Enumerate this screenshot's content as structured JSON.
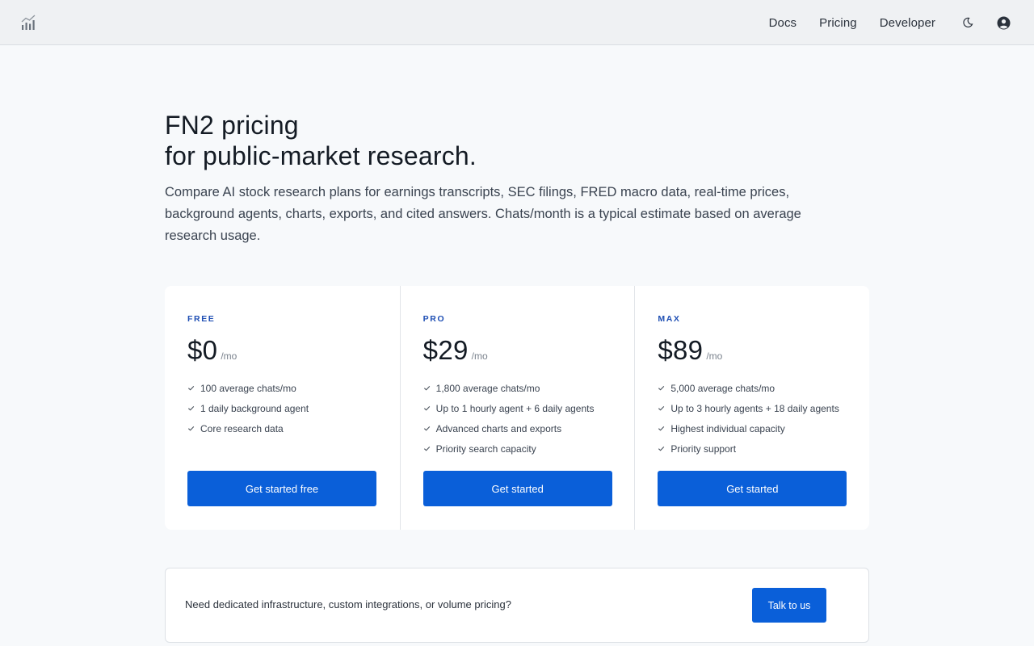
{
  "nav": {
    "items": [
      "Docs",
      "Pricing",
      "Developer"
    ]
  },
  "hero": {
    "title_line1": "FN2 pricing",
    "title_line2": "for public-market research.",
    "subtitle": "Compare AI stock research plans for earnings transcripts, SEC filings, FRED macro data, real-time prices, background agents, charts, exports, and cited answers. Chats/month is a typical estimate based on average research usage."
  },
  "plans": [
    {
      "name": "FREE",
      "price": "$0",
      "period": "/mo",
      "features": [
        "100 average chats/mo",
        "1 daily background agent",
        "Core research data"
      ],
      "cta": "Get started free"
    },
    {
      "name": "PRO",
      "price": "$29",
      "period": "/mo",
      "features": [
        "1,800 average chats/mo",
        "Up to 1 hourly agent + 6 daily agents",
        "Advanced charts and exports",
        "Priority search capacity"
      ],
      "cta": "Get started"
    },
    {
      "name": "MAX",
      "price": "$89",
      "period": "/mo",
      "features": [
        "5,000 average chats/mo",
        "Up to 3 hourly agents + 18 daily agents",
        "Highest individual capacity",
        "Priority support"
      ],
      "cta": "Get started"
    }
  ],
  "enterprise": {
    "text": "Need dedicated infrastructure, custom integrations, or volume pricing?",
    "cta": "Talk to us"
  },
  "colors": {
    "accent": "#0a5fd9",
    "plan_label": "#1f4fb4",
    "header_bg": "#eff1f3",
    "page_bg": "#f7f9fb"
  },
  "icons": {
    "logo": "bar-chart-logo-icon",
    "theme": "moon-icon",
    "account": "user-circle-icon",
    "feature": "check-icon"
  }
}
